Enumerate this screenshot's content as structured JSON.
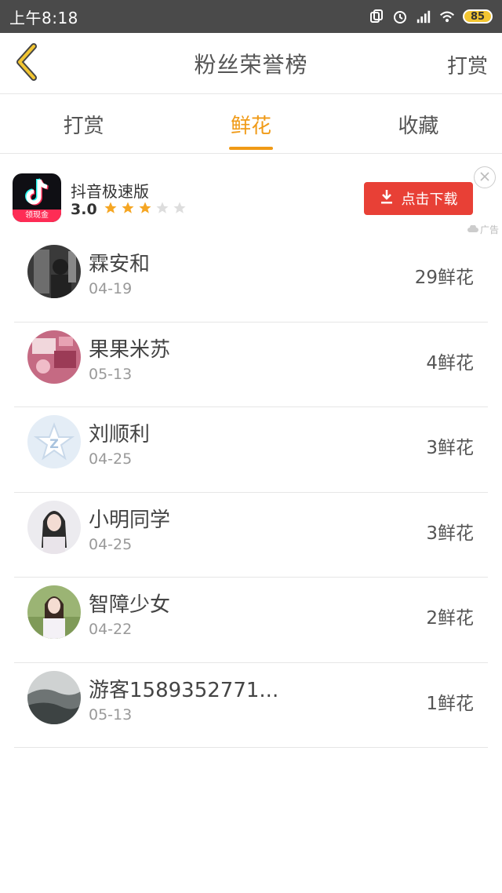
{
  "status_bar": {
    "time": "上午8:18",
    "battery": "85",
    "icons": [
      "sim-icon",
      "alarm-icon",
      "signal-icon",
      "wifi-icon"
    ]
  },
  "header": {
    "title": "粉丝荣誉榜",
    "action_label": "打赏",
    "back_icon": "chevron-left-icon"
  },
  "tabs": [
    {
      "label": "打赏",
      "active": false
    },
    {
      "label": "鲜花",
      "active": true
    },
    {
      "label": "收藏",
      "active": false
    }
  ],
  "ad": {
    "app_name": "抖音极速版",
    "icon_badge": "领现金",
    "rating": "3.0",
    "stars_filled": 3,
    "stars_total": 5,
    "button_label": "点击下载",
    "ad_tag": "广告"
  },
  "list": [
    {
      "name": "霖安和",
      "date": "04-19",
      "count": "29鲜花"
    },
    {
      "name": "果果米苏",
      "date": "05-13",
      "count": "4鲜花"
    },
    {
      "name": "刘顺利",
      "date": "04-25",
      "count": "3鲜花"
    },
    {
      "name": "小明同学",
      "date": "04-25",
      "count": "3鲜花"
    },
    {
      "name": "智障少女",
      "date": "04-22",
      "count": "2鲜花"
    },
    {
      "name": "游客1589352771...",
      "date": "05-13",
      "count": "1鲜花"
    }
  ],
  "colors": {
    "accent": "#f09a16",
    "download_button": "#e84036",
    "star": "#f5a623"
  }
}
